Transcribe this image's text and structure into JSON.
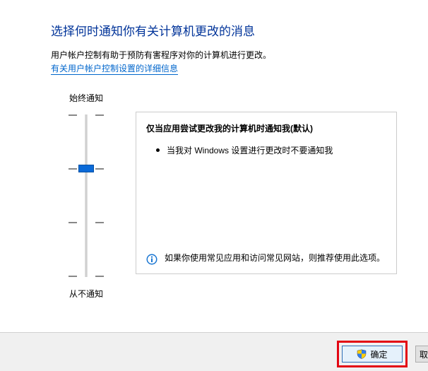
{
  "header": {
    "title": "选择何时通知你有关计算机更改的消息",
    "desc": "用户帐户控制有助于预防有害程序对你的计算机进行更改。",
    "link": "有关用户帐户控制设置的详细信息"
  },
  "slider": {
    "top_label": "始终通知",
    "bottom_label": "从不通知",
    "level": 2,
    "levels_total": 4
  },
  "panel": {
    "heading": "仅当应用尝试更改我的计算机时通知我(默认)",
    "bullet": "当我对 Windows 设置进行更改时不要通知我",
    "info": "如果你使用常见应用和访问常见网站，则推荐使用此选项。"
  },
  "buttons": {
    "ok": "确定",
    "cancel_visible": "取"
  }
}
